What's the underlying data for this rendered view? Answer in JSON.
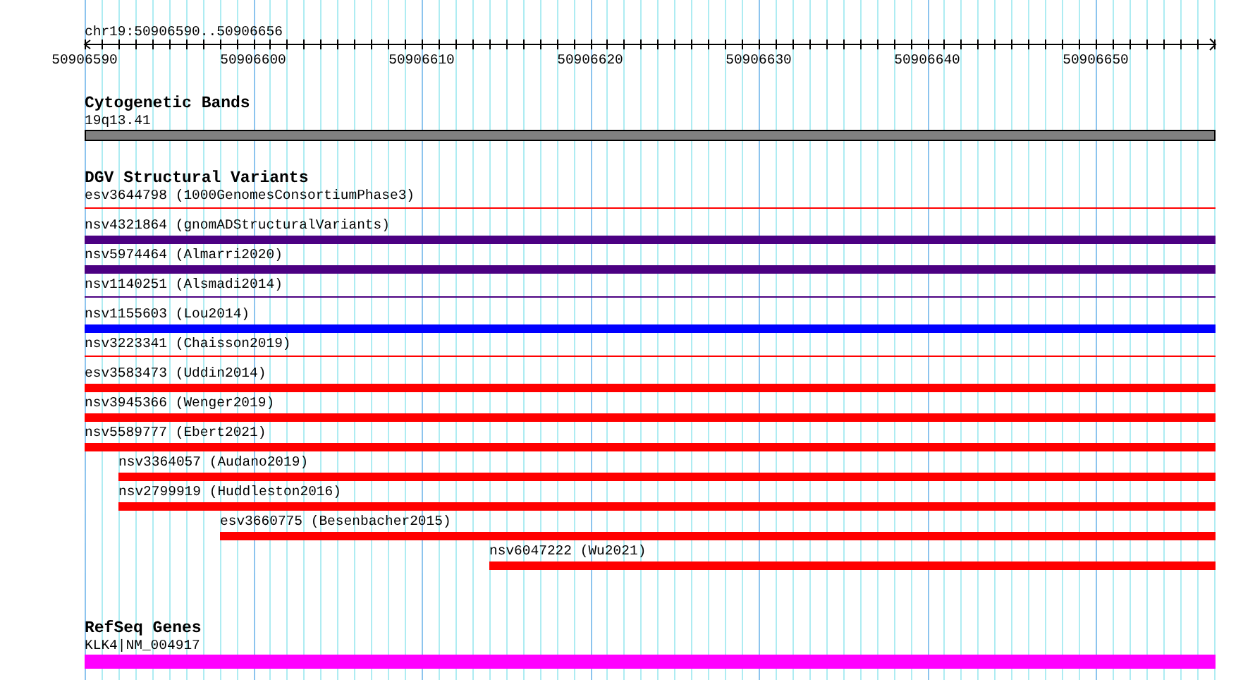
{
  "location": "chr19:50906590..50906656",
  "ruler": {
    "ticks": [
      "50906590",
      "50906600",
      "50906610",
      "50906620",
      "50906630",
      "50906640",
      "50906650"
    ]
  },
  "tracks": [
    {
      "title": "Cytogenetic Bands",
      "features": [
        {
          "label": "19q13.41",
          "kind": "band",
          "color": "#808080",
          "level": 1
        }
      ]
    },
    {
      "title": "DGV Structural Variants",
      "features": [
        {
          "label": "esv3644798 (1000GenomesConsortiumPhase3)",
          "kind": "thin",
          "color": "#ff0000",
          "level": 1
        },
        {
          "label": "nsv4321864 (gnomADStructuralVariants)",
          "kind": "bar",
          "color": "#4b0082",
          "level": 1
        },
        {
          "label": "nsv5974464 (Almarri2020)",
          "kind": "bar",
          "color": "#4b0082",
          "level": 1
        },
        {
          "label": "nsv1140251 (Alsmadi2014)",
          "kind": "thin",
          "color": "#4b0082",
          "level": 1
        },
        {
          "label": "nsv1155603 (Lou2014)",
          "kind": "bar",
          "color": "#0000ff",
          "level": 1
        },
        {
          "label": "nsv3223341 (Chaisson2019)",
          "kind": "thin",
          "color": "#ff0000",
          "level": 1
        },
        {
          "label": "esv3583473 (Uddin2014)",
          "kind": "bar",
          "color": "#ff0000",
          "level": 1
        },
        {
          "label": "nsv3945366 (Wenger2019)",
          "kind": "bar",
          "color": "#ff0000",
          "level": 1
        },
        {
          "label": "nsv5589777 (Ebert2021)",
          "kind": "bar",
          "color": "#ff0000",
          "level": 1
        },
        {
          "label": "nsv3364057 (Audano2019)",
          "kind": "bar",
          "color": "#ff0000",
          "level": 0.97
        },
        {
          "label": "nsv2799919 (Huddleston2016)",
          "kind": "bar",
          "color": "#ff0000",
          "level": 0.97
        },
        {
          "label": "esv3660775 (Besenbacher2015)",
          "kind": "bar",
          "color": "#ff0000",
          "level": 0.88
        },
        {
          "label": "nsv6047222 (Wu2021)",
          "kind": "bar",
          "color": "#ff0000",
          "level": 0.642
        }
      ]
    },
    {
      "title": "RefSeq Genes",
      "features": [
        {
          "label": "KLK4|NM_004917",
          "kind": "gene",
          "color": "#ff00ff",
          "level": 1
        }
      ]
    }
  ]
}
